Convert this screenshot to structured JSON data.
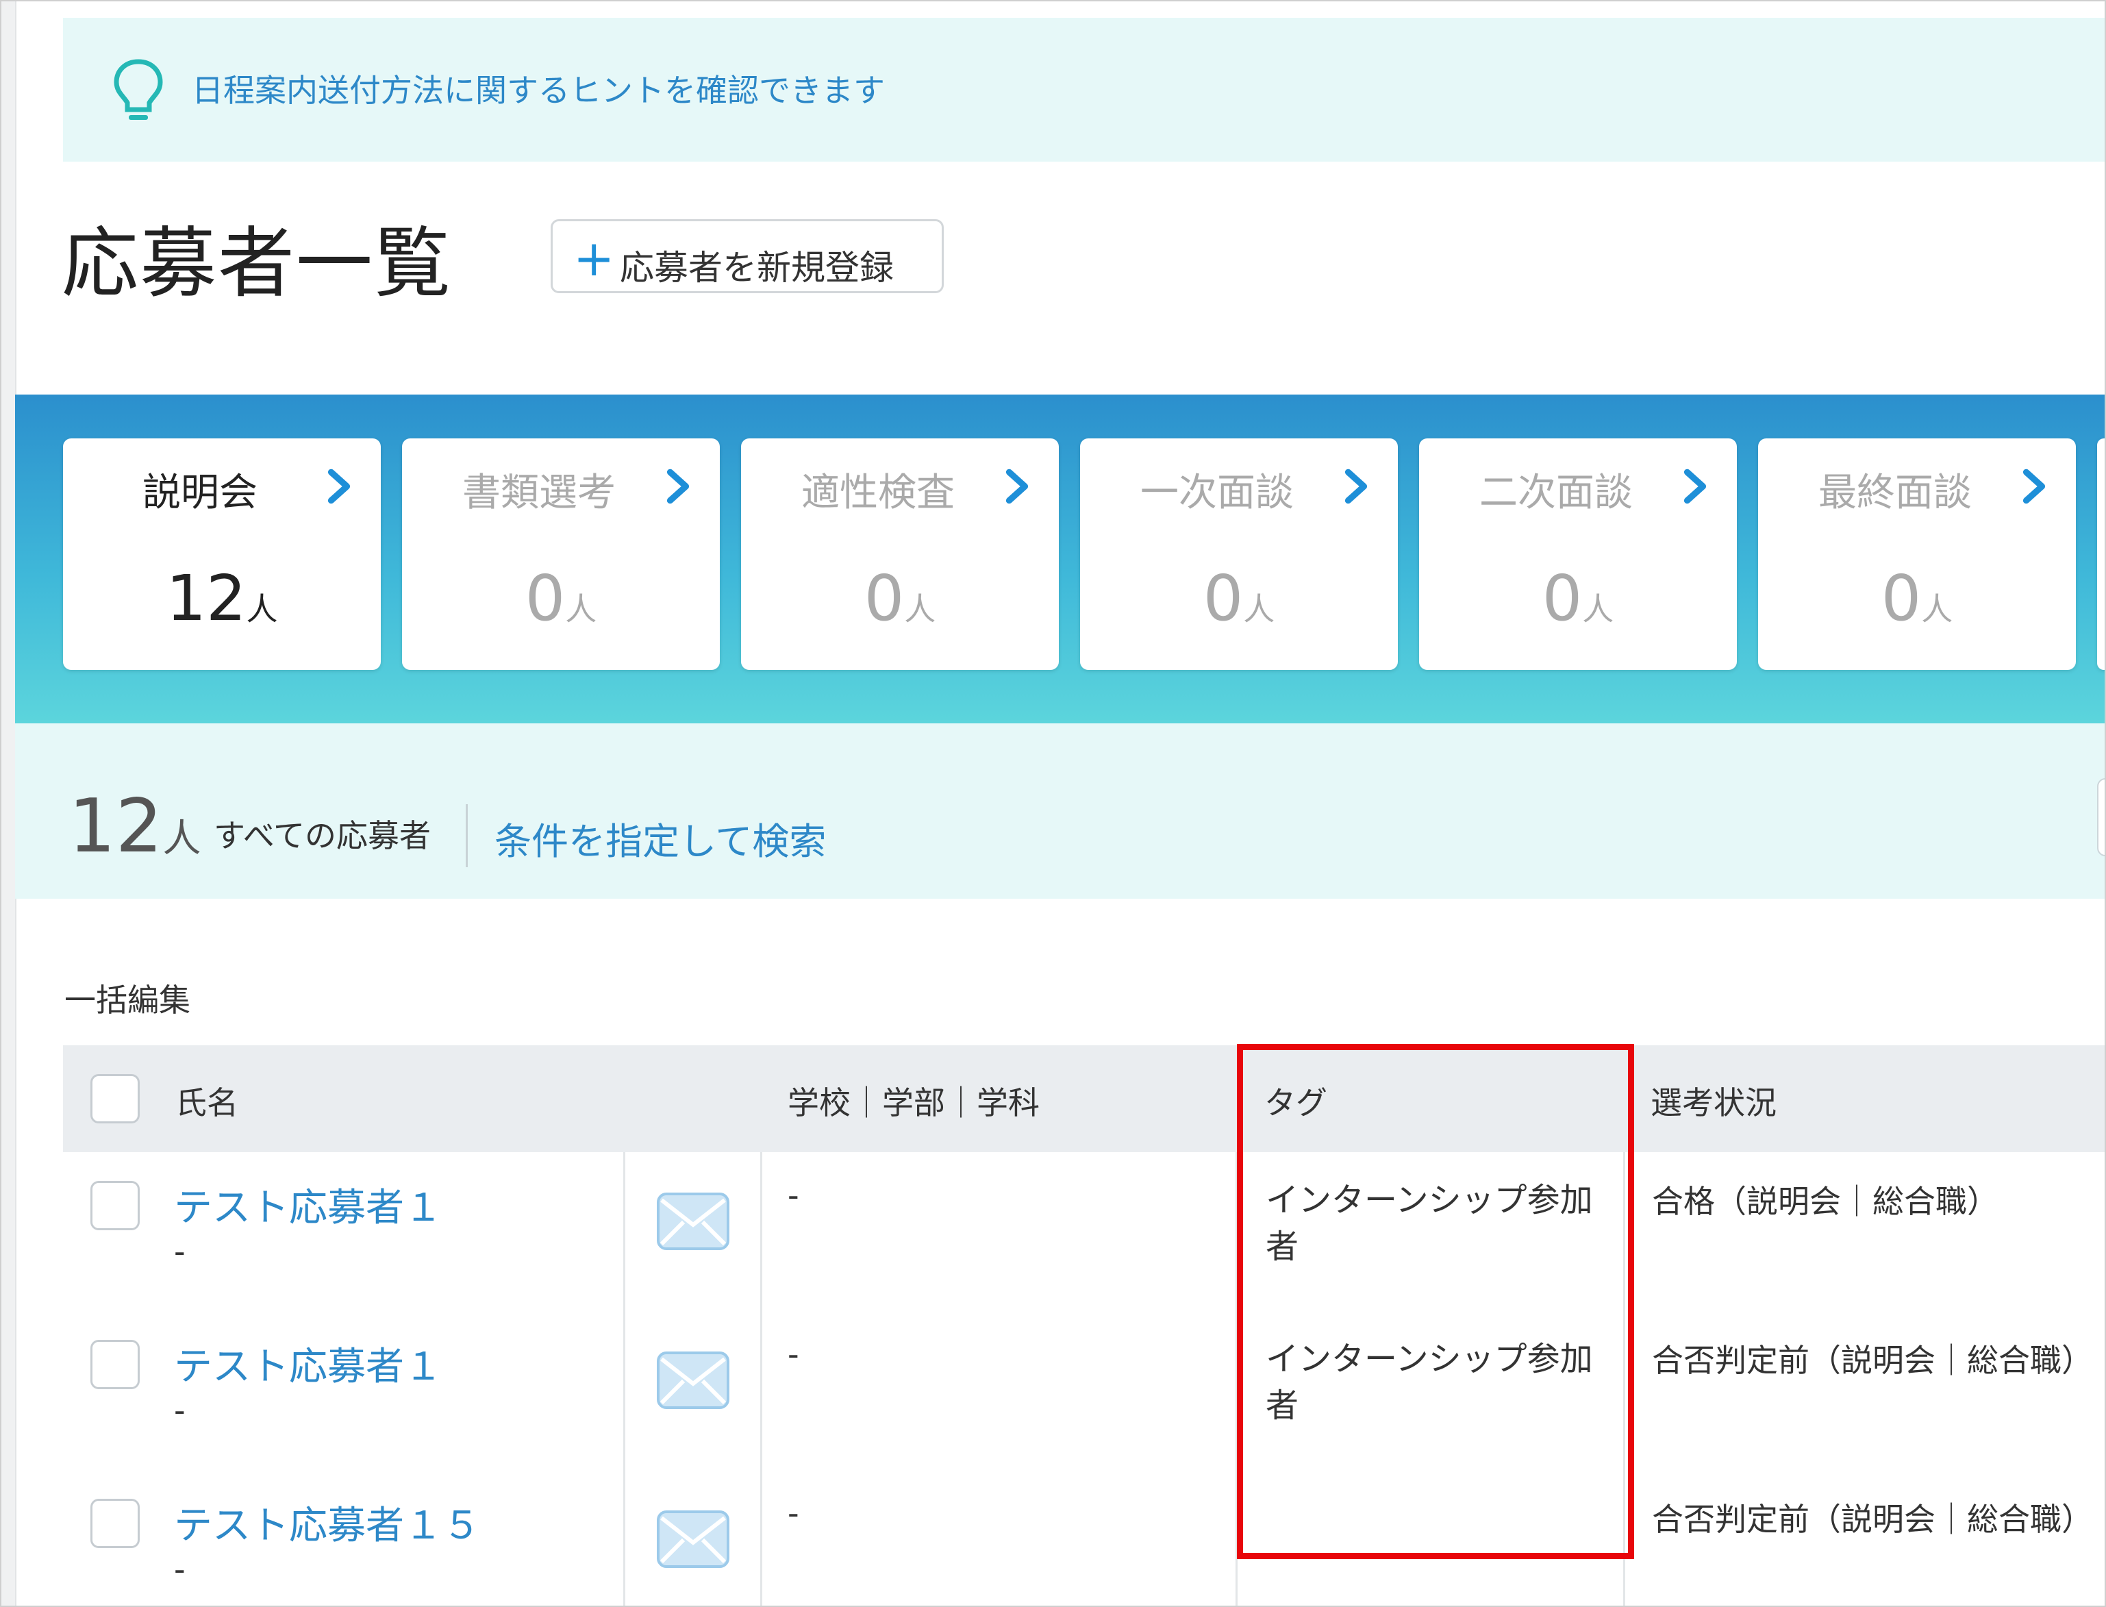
{
  "hint": {
    "icon": "lightbulb-icon",
    "text": "日程案内送付方法に関するヒントを確認できます"
  },
  "header": {
    "title": "応募者一覧",
    "new_button_icon": "+",
    "new_button_label": "応募者を新規登録"
  },
  "stages": [
    {
      "name": "説明会",
      "count": "12",
      "unit": "人",
      "active": true
    },
    {
      "name": "書類選考",
      "count": "0",
      "unit": "人",
      "active": false
    },
    {
      "name": "適性検査",
      "count": "0",
      "unit": "人",
      "active": false
    },
    {
      "name": "一次面談",
      "count": "0",
      "unit": "人",
      "active": false
    },
    {
      "name": "二次面談",
      "count": "0",
      "unit": "人",
      "active": false
    },
    {
      "name": "最終面談",
      "count": "0",
      "unit": "人",
      "active": false
    }
  ],
  "summary": {
    "total": "12",
    "unit": "人",
    "all_label": "すべての応募者",
    "search_link": "条件を指定して検索"
  },
  "bulk_edit_label": "一括編集",
  "table": {
    "columns": {
      "name": "氏名",
      "school": "学校｜学部｜学科",
      "tag": "タグ",
      "status": "選考状況"
    },
    "rows": [
      {
        "name": "テスト応募者１",
        "sub": "-",
        "school": "-",
        "tag": "インターンシップ参加者",
        "status": "合格（説明会｜総合職）"
      },
      {
        "name": "テスト応募者１",
        "sub": "-",
        "school": "-",
        "tag": "インターンシップ参加者",
        "status": "合否判定前（説明会｜総合職）"
      },
      {
        "name": "テスト応募者１５",
        "sub": "-",
        "school": "-",
        "tag": "",
        "status": "合否判定前（説明会｜総合職）"
      }
    ]
  },
  "colors": {
    "accent": "#2d88c8",
    "highlight": "#e8060b",
    "band_top": "#2b8fcd",
    "band_bottom": "#5cd5dc",
    "hint_bg": "#e6f8f8"
  }
}
